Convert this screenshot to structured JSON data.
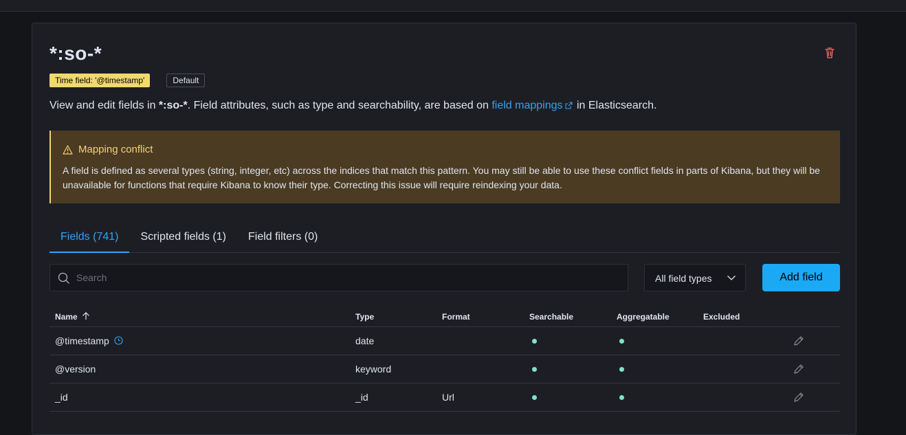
{
  "header": {
    "title": "*:so-*",
    "time_field_badge": "Time field: '@timestamp'",
    "default_badge": "Default"
  },
  "description": {
    "prefix": "View and edit fields in ",
    "pattern": "*:so-*",
    "middle": ". Field attributes, such as type and searchability, are based on ",
    "link": "field mappings",
    "suffix": " in Elasticsearch."
  },
  "callout": {
    "title": "Mapping conflict",
    "body": "A field is defined as several types (string, integer, etc) across the indices that match this pattern. You may still be able to use these conflict fields in parts of Kibana, but they will be unavailable for functions that require Kibana to know their type. Correcting this issue will require reindexing your data."
  },
  "tabs": [
    {
      "label": "Fields (741)",
      "active": true
    },
    {
      "label": "Scripted fields (1)",
      "active": false
    },
    {
      "label": "Field filters (0)",
      "active": false
    }
  ],
  "toolbar": {
    "search_placeholder": "Search",
    "type_filter": "All field types",
    "add_button": "Add field"
  },
  "table": {
    "columns": {
      "name": "Name",
      "type": "Type",
      "format": "Format",
      "searchable": "Searchable",
      "aggregatable": "Aggregatable",
      "excluded": "Excluded"
    },
    "rows": [
      {
        "name": "@timestamp",
        "type": "date",
        "format": "",
        "searchable": true,
        "aggregatable": true,
        "time_field": true
      },
      {
        "name": "@version",
        "type": "keyword",
        "format": "",
        "searchable": true,
        "aggregatable": true,
        "time_field": false
      },
      {
        "name": "_id",
        "type": "_id",
        "format": "Url",
        "searchable": true,
        "aggregatable": true,
        "time_field": false
      }
    ]
  },
  "colors": {
    "accent": "#36a2ef",
    "primary_button": "#1ba9f5",
    "warning": "#f3d371",
    "success_dot": "#7de2d1",
    "danger": "#f86b63"
  }
}
